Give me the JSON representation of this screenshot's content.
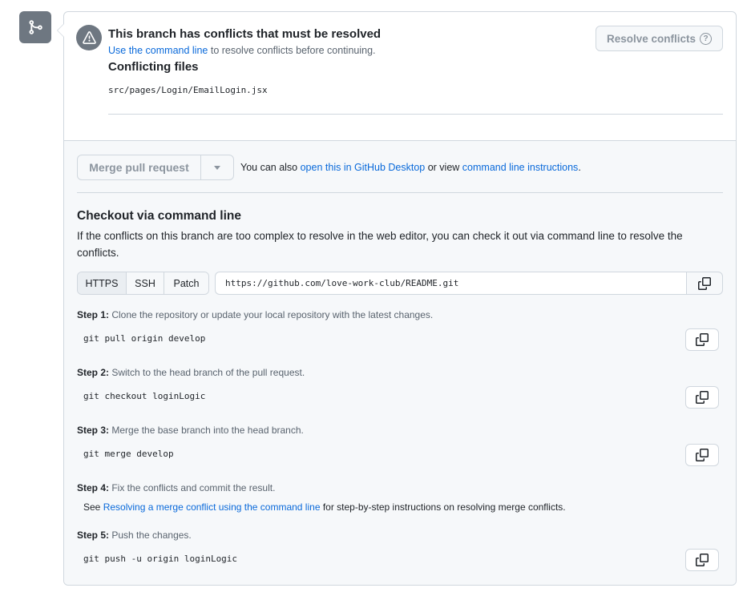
{
  "icons": {
    "merge": "git-merge-icon",
    "alert": "alert-icon",
    "help": "question-icon",
    "copy": "copy-icon",
    "caret": "triangle-down-icon"
  },
  "colors": {
    "link": "#0969da",
    "icon_bg": "#6e7781",
    "border": "#d0d7de",
    "muted_button_text": "#8c959f",
    "section_bg": "#f6f8fa"
  },
  "conflict": {
    "title": "This branch has conflicts that must be resolved",
    "link_text": "Use the command line",
    "sub_text": " to resolve conflicts before continuing.",
    "files_title": "Conflicting files",
    "files": [
      "src/pages/Login/EmailLogin.jsx"
    ],
    "resolve_button": "Resolve conflicts",
    "help_glyph": "?"
  },
  "merge": {
    "button_label": "Merge pull request",
    "also_prefix": "You can also ",
    "desktop_link": "open this in GitHub Desktop",
    "or_view": " or view ",
    "cli_link": "command line instructions",
    "period": "."
  },
  "checkout": {
    "title": "Checkout via command line",
    "description": "If the conflicts on this branch are too complex to resolve in the web editor, you can check it out via command line to resolve the conflicts.",
    "tabs": [
      "HTTPS",
      "SSH",
      "Patch"
    ],
    "active_tab": "HTTPS",
    "url": "https://github.com/love-work-club/README.git"
  },
  "steps": [
    {
      "label": "Step 1:",
      "text": " Clone the repository or update your local repository with the latest changes.",
      "code": "git pull origin develop"
    },
    {
      "label": "Step 2:",
      "text": " Switch to the head branch of the pull request.",
      "code": "git checkout loginLogic"
    },
    {
      "label": "Step 3:",
      "text": " Merge the base branch into the head branch.",
      "code": "git merge develop"
    },
    {
      "label": "Step 4:",
      "text": " Fix the conflicts and commit the result.",
      "note_prefix": "See ",
      "note_link": "Resolving a merge conflict using the command line",
      "note_suffix": " for step-by-step instructions on resolving merge conflicts."
    },
    {
      "label": "Step 5:",
      "text": " Push the changes.",
      "code": "git push -u origin loginLogic"
    }
  ]
}
